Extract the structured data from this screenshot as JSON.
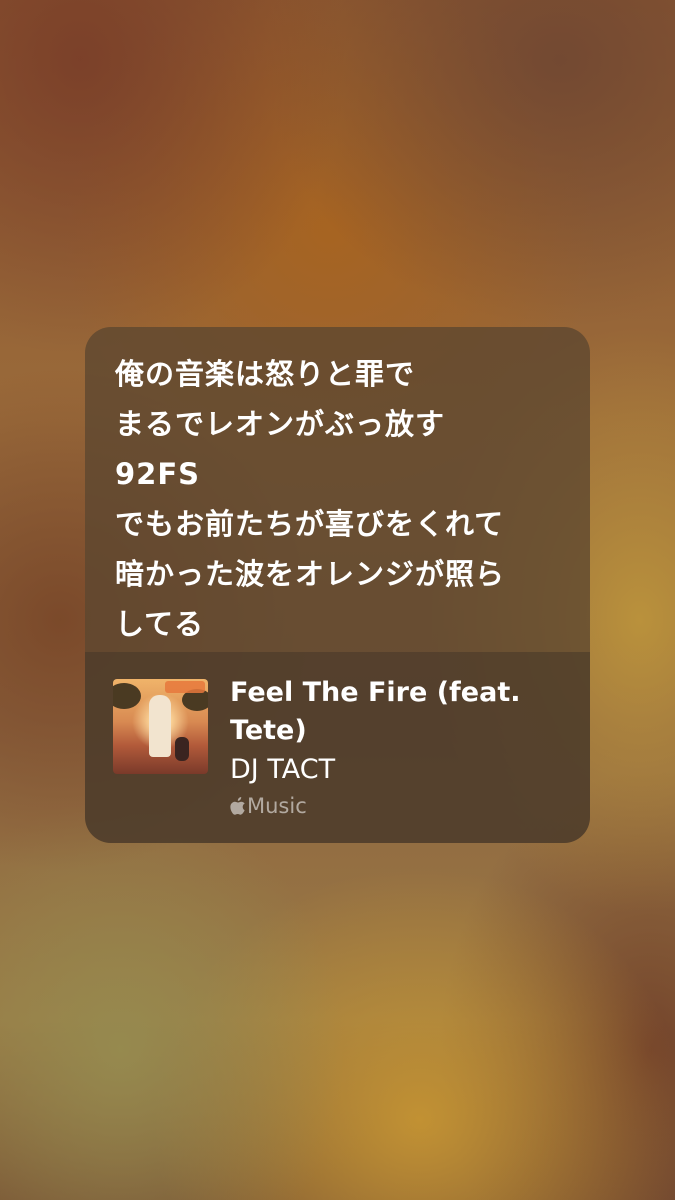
{
  "lyrics": {
    "lines": [
      "俺の音楽は怒りと罪で",
      "まるでレオンがぶっ放す",
      "92FS",
      "でもお前たちが喜びをくれて",
      "暗かった波をオレンジが照ら",
      "してる"
    ]
  },
  "track": {
    "title": "Feel The Fire (feat. Tete)",
    "artist": "DJ TACT",
    "service": "Music",
    "service_icon": "apple-logo-icon"
  },
  "colors": {
    "text": "#ffffff",
    "service_text": "rgba(255,255,255,0.55)"
  }
}
